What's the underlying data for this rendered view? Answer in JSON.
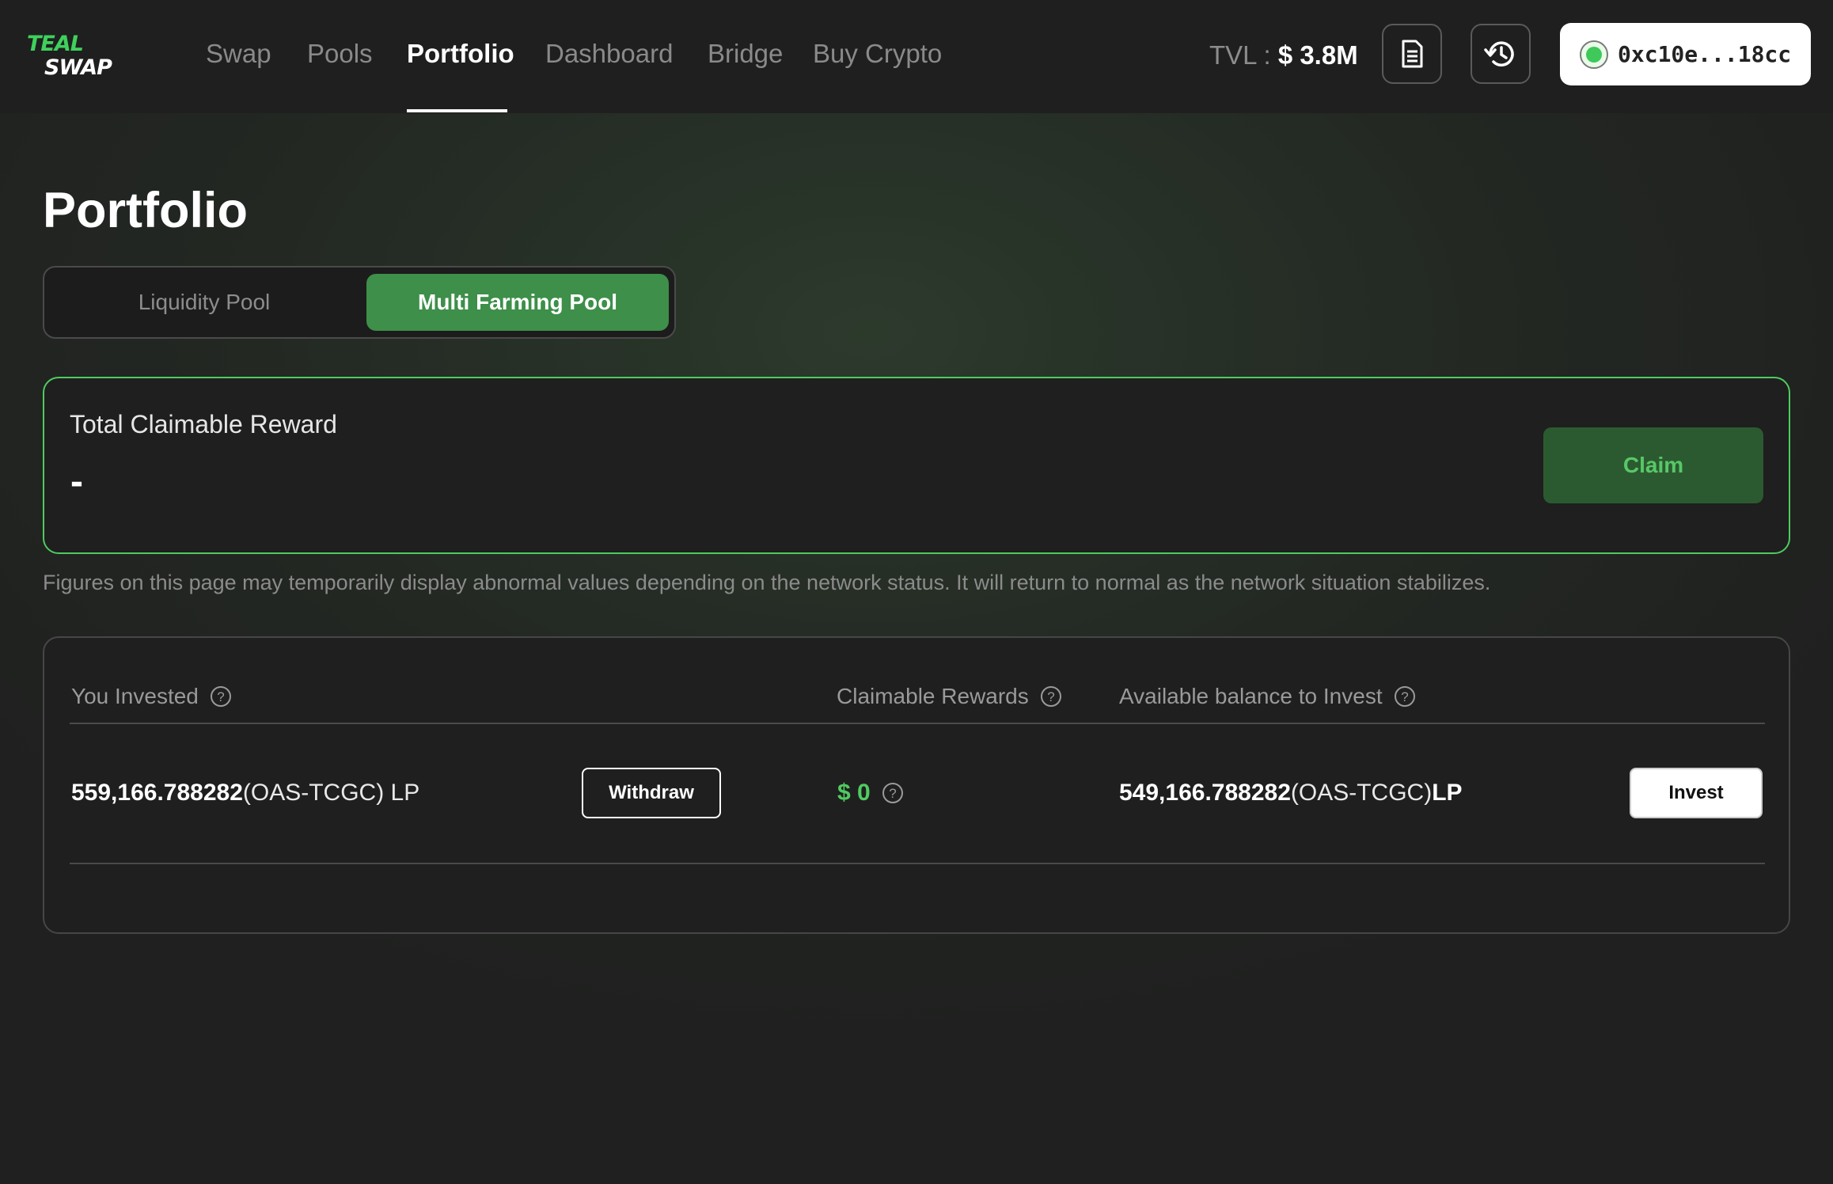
{
  "nav": {
    "logo_text": "TEAL SWAP",
    "links": [
      "Swap",
      "Pools",
      "Portfolio",
      "Dashboard",
      "Bridge",
      "Buy Crypto"
    ],
    "active": "Portfolio",
    "tvl_label": "TVL : ",
    "tvl_value": "$ 3.8M",
    "docs_icon": "document-icon",
    "history_icon": "history-icon",
    "wallet_address": "0xc10e...18cc"
  },
  "page": {
    "title": "Portfolio",
    "tabs": [
      "Liquidity Pool",
      "Multi Farming Pool"
    ],
    "selected_tab": "Multi Farming Pool"
  },
  "reward": {
    "label": "Total Claimable Reward",
    "value": "-",
    "claim_label": "Claim"
  },
  "notice": "Figures on this page may temporarily display abnormal values depending on the network status. It will return to normal as the network situation stabilizes.",
  "table": {
    "headers": [
      "You Invested",
      "Claimable Rewards",
      "Available balance to Invest"
    ],
    "row": {
      "invested_amount": "559,166.788282",
      "invested_pair": " (OAS-TCGC) LP",
      "withdraw_label": "Withdraw",
      "claimable": "$ 0",
      "available_amount": "549,166.788282",
      "available_pair": " (OAS-TCGC) ",
      "available_unit": "LP",
      "invest_label": "Invest"
    }
  },
  "colors": {
    "accent": "#4ecb5f",
    "tab_active": "#3d8f49",
    "claim_bg": "#2c5a30"
  }
}
